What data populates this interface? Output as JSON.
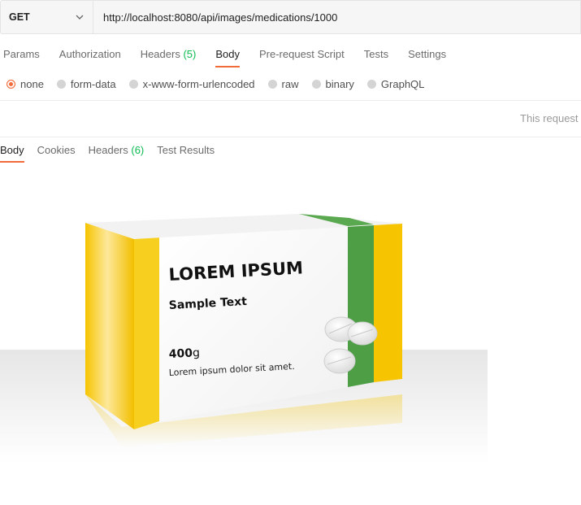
{
  "request": {
    "method": "GET",
    "url": "http://localhost:8080/api/images/medications/1000"
  },
  "request_tabs": [
    {
      "label": "Params",
      "count": ""
    },
    {
      "label": "Authorization",
      "count": ""
    },
    {
      "label": "Headers",
      "count": "(5)"
    },
    {
      "label": "Body",
      "count": ""
    },
    {
      "label": "Pre-request Script",
      "count": ""
    },
    {
      "label": "Tests",
      "count": ""
    },
    {
      "label": "Settings",
      "count": ""
    }
  ],
  "active_request_tab": "Body",
  "body_types": [
    "none",
    "form-data",
    "x-www-form-urlencoded",
    "raw",
    "binary",
    "GraphQL"
  ],
  "selected_body_type": "none",
  "notice": "This request d",
  "response_tabs": [
    {
      "label": "Body",
      "count": ""
    },
    {
      "label": "Cookies",
      "count": ""
    },
    {
      "label": "Headers",
      "count": "(6)"
    },
    {
      "label": "Test Results",
      "count": ""
    }
  ],
  "active_response_tab": "Body",
  "image": {
    "title": "LOREM IPSUM",
    "subtitle": "Sample Text",
    "weight_number": "400",
    "weight_unit": "g",
    "description": "Lorem ipsum dolor sit amet."
  },
  "colors": {
    "accent": "#f26b3a",
    "count_green": "#0cbb52",
    "box_yellow": "#f5c400",
    "box_green": "#4e9e45"
  }
}
